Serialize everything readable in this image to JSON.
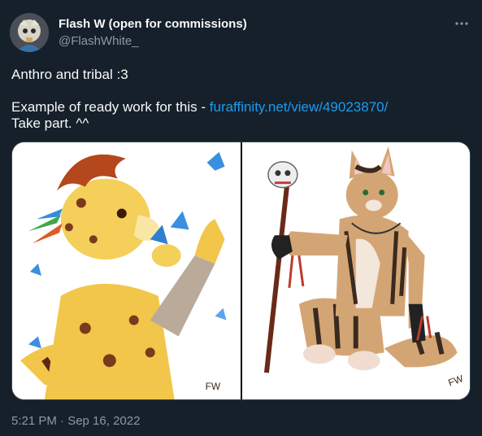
{
  "author": {
    "display_name": "Flash W (open for commissions)",
    "handle": "@FlashWhite_"
  },
  "tweet": {
    "line1": "Anthro and tribal :3",
    "line2_prefix": "Example of ready work for this - ",
    "line2_link": "furaffinity.net/view/49023870/",
    "line3": "Take part. ^^"
  },
  "media": {
    "signature_left": "FW",
    "signature_right": "FW"
  },
  "timestamp": "5:21 PM · Sep 16, 2022",
  "colors": {
    "background": "#15202b",
    "link": "#1d9bf0",
    "secondary_text": "#8b98a5"
  }
}
